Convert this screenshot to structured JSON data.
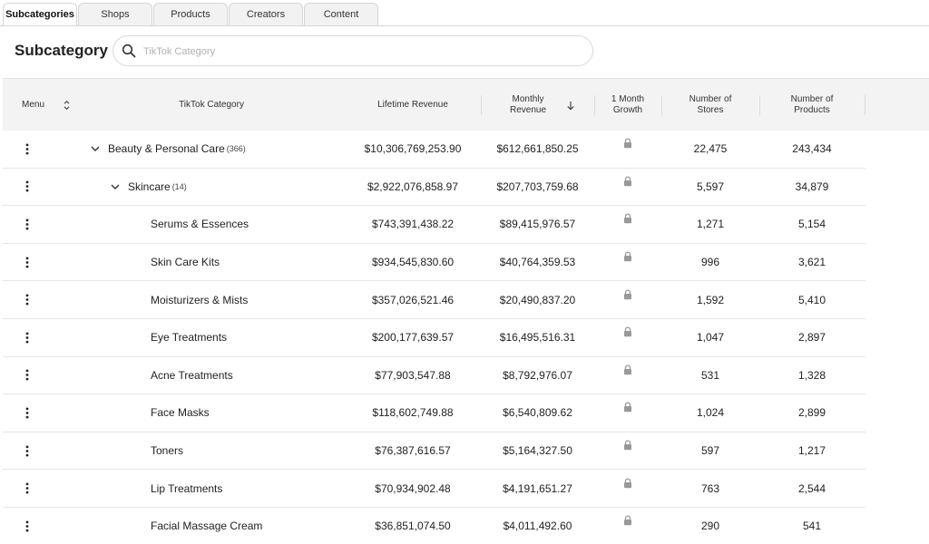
{
  "tabs": [
    {
      "label": "Subcategories",
      "active": true
    },
    {
      "label": "Shops",
      "active": false
    },
    {
      "label": "Products",
      "active": false
    },
    {
      "label": "Creators",
      "active": false
    },
    {
      "label": "Content",
      "active": false
    }
  ],
  "header": {
    "title": "Subcategory",
    "search_placeholder": "TikTok Category",
    "search_value": ""
  },
  "columns": {
    "menu": "Menu",
    "category": "TikTok Category",
    "lifetime_revenue": "Lifetime Revenue",
    "monthly_revenue_line1": "Monthly",
    "monthly_revenue_line2": "Revenue",
    "growth_line1": "1 Month",
    "growth_line2": "Growth",
    "stores_line1": "Number of",
    "stores_line2": "Stores",
    "products_line1": "Number of",
    "products_line2": "Products"
  },
  "rows": [
    {
      "name": "Beauty & Personal Care",
      "count": "(366)",
      "level": 0,
      "expanded": true,
      "lifetime": "$10,306,769,253.90",
      "monthly": "$612,661,850.25",
      "stores": "22,475",
      "products": "243,434"
    },
    {
      "name": "Skincare",
      "count": "(14)",
      "level": 1,
      "expanded": true,
      "lifetime": "$2,922,076,858.97",
      "monthly": "$207,703,759.68",
      "stores": "5,597",
      "products": "34,879"
    },
    {
      "name": "Serums & Essences",
      "count": "",
      "level": 2,
      "lifetime": "$743,391,438.22",
      "monthly": "$89,415,976.57",
      "stores": "1,271",
      "products": "5,154"
    },
    {
      "name": "Skin Care Kits",
      "count": "",
      "level": 2,
      "lifetime": "$934,545,830.60",
      "monthly": "$40,764,359.53",
      "stores": "996",
      "products": "3,621"
    },
    {
      "name": "Moisturizers & Mists",
      "count": "",
      "level": 2,
      "lifetime": "$357,026,521.46",
      "monthly": "$20,490,837.20",
      "stores": "1,592",
      "products": "5,410"
    },
    {
      "name": "Eye Treatments",
      "count": "",
      "level": 2,
      "lifetime": "$200,177,639.57",
      "monthly": "$16,495,516.31",
      "stores": "1,047",
      "products": "2,897"
    },
    {
      "name": "Acne Treatments",
      "count": "",
      "level": 2,
      "lifetime": "$77,903,547.88",
      "monthly": "$8,792,976.07",
      "stores": "531",
      "products": "1,328"
    },
    {
      "name": "Face Masks",
      "count": "",
      "level": 2,
      "lifetime": "$118,602,749.88",
      "monthly": "$6,540,809.62",
      "stores": "1,024",
      "products": "2,899"
    },
    {
      "name": "Toners",
      "count": "",
      "level": 2,
      "lifetime": "$76,387,616.57",
      "monthly": "$5,164,327.50",
      "stores": "597",
      "products": "1,217"
    },
    {
      "name": "Lip Treatments",
      "count": "",
      "level": 2,
      "lifetime": "$70,934,902.48",
      "monthly": "$4,191,651.27",
      "stores": "763",
      "products": "2,544"
    },
    {
      "name": "Facial Massage Cream",
      "count": "",
      "level": 2,
      "lifetime": "$36,851,074.50",
      "monthly": "$4,011,492.60",
      "stores": "290",
      "products": "541"
    }
  ],
  "icons": {
    "search": "search-icon",
    "sort": "sort-icon",
    "sort_desc": "arrow-down-icon",
    "lock": "lock-icon",
    "menu": "kebab-menu-icon",
    "expand": "chevron-down-icon"
  }
}
